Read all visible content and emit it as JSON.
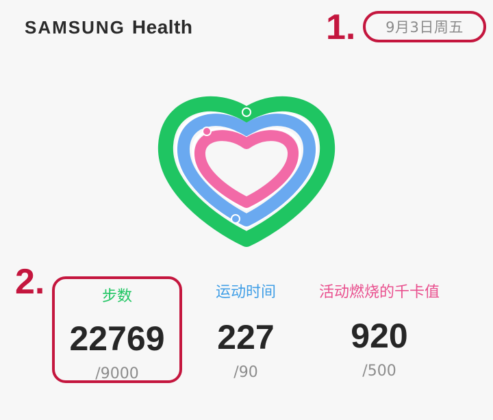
{
  "header": {
    "brand_main": "SAMSUNG",
    "brand_sub": "Health",
    "date": "9月3日周五"
  },
  "annotations": {
    "one": "1.",
    "two": "2."
  },
  "rings": {
    "colors": {
      "steps": "#1fc562",
      "active_time": "#6aa9f0",
      "calories": "#f26aa7"
    },
    "icon": "heart-rings-icon"
  },
  "stats": {
    "steps": {
      "label": "步数",
      "value": "22769",
      "target": "/9000"
    },
    "active_time": {
      "label": "运动时间",
      "value": "227",
      "target": "/90"
    },
    "calories": {
      "label": "活动燃烧的千卡值",
      "value": "920",
      "target": "/500"
    }
  },
  "accent_color": "#c4163e"
}
